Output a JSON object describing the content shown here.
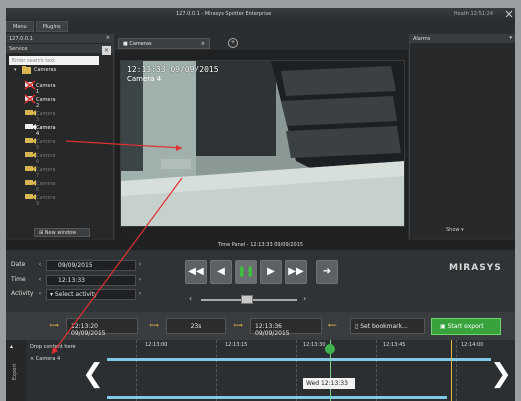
{
  "window": {
    "title": "127.0.0.1 - Mirasys Spotter Enterprise",
    "right_info": "Heath  12:51:24"
  },
  "tabs": [
    "Menu",
    "Plugins"
  ],
  "left": {
    "server": "127.0.0.1",
    "panel_title": "Service",
    "search_placeholder": "Enter search text",
    "root": "Cameras",
    "cameras": [
      "Camera 1",
      "Camera 2",
      "Camera 3",
      "Camera 4",
      "Camera 5",
      "Camera 6",
      "Camera 7",
      "Camera 8",
      "Camera 9"
    ],
    "new_window": "New window"
  },
  "camera_tab": "Cameras",
  "video": {
    "timestamp": "12:13:33  09/09/2015",
    "label": "Camera 4"
  },
  "alarms": {
    "title": "Alarms",
    "show": "Show"
  },
  "time_panel": "Time Panel - 12:13:33  09/09/2015",
  "controls": {
    "date_label": "Date",
    "date_value": "09/09/2015",
    "time_label": "Time",
    "time_value": "12:13:33",
    "activity_label": "Activity",
    "activity_value": "Select activity"
  },
  "brand": "MIRASYS",
  "export": {
    "start": "12:13:20 09/09/2015",
    "duration": "23s",
    "end": "12:13:36 09/09/2015",
    "bookmark": "Set bookmark...",
    "start_export": "Start export"
  },
  "timeline": {
    "side_label": "Export",
    "drop_text": "Drop content here",
    "row_label": "Camera 4",
    "ticks": [
      "12:13:00",
      "12:13:15",
      "12:13:30",
      "12:13:45",
      "12:14:00"
    ],
    "tooltip": "Wed 12:13:33"
  },
  "colors": {
    "accent_green": "#38a33c",
    "timeline_blue": "#7fc9e6",
    "marker_yellow": "#e8b84a",
    "annotation_red": "#e03030"
  }
}
